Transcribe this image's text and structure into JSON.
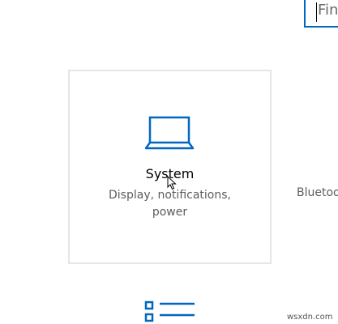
{
  "search": {
    "placeholder": "Find"
  },
  "tiles": [
    {
      "title": "System",
      "description_line1": "Display, notifications,",
      "description_line2": "power",
      "icon": "laptop-icon"
    }
  ],
  "adjacent_tile": {
    "label": "Bluetoo"
  },
  "next_row_icon": "list-icon",
  "watermark": "wsxdn.com",
  "colors": {
    "accent": "#0067c0",
    "tile_border": "#e6e6e6",
    "text_primary": "#000000",
    "text_secondary": "#5d5d5d"
  }
}
